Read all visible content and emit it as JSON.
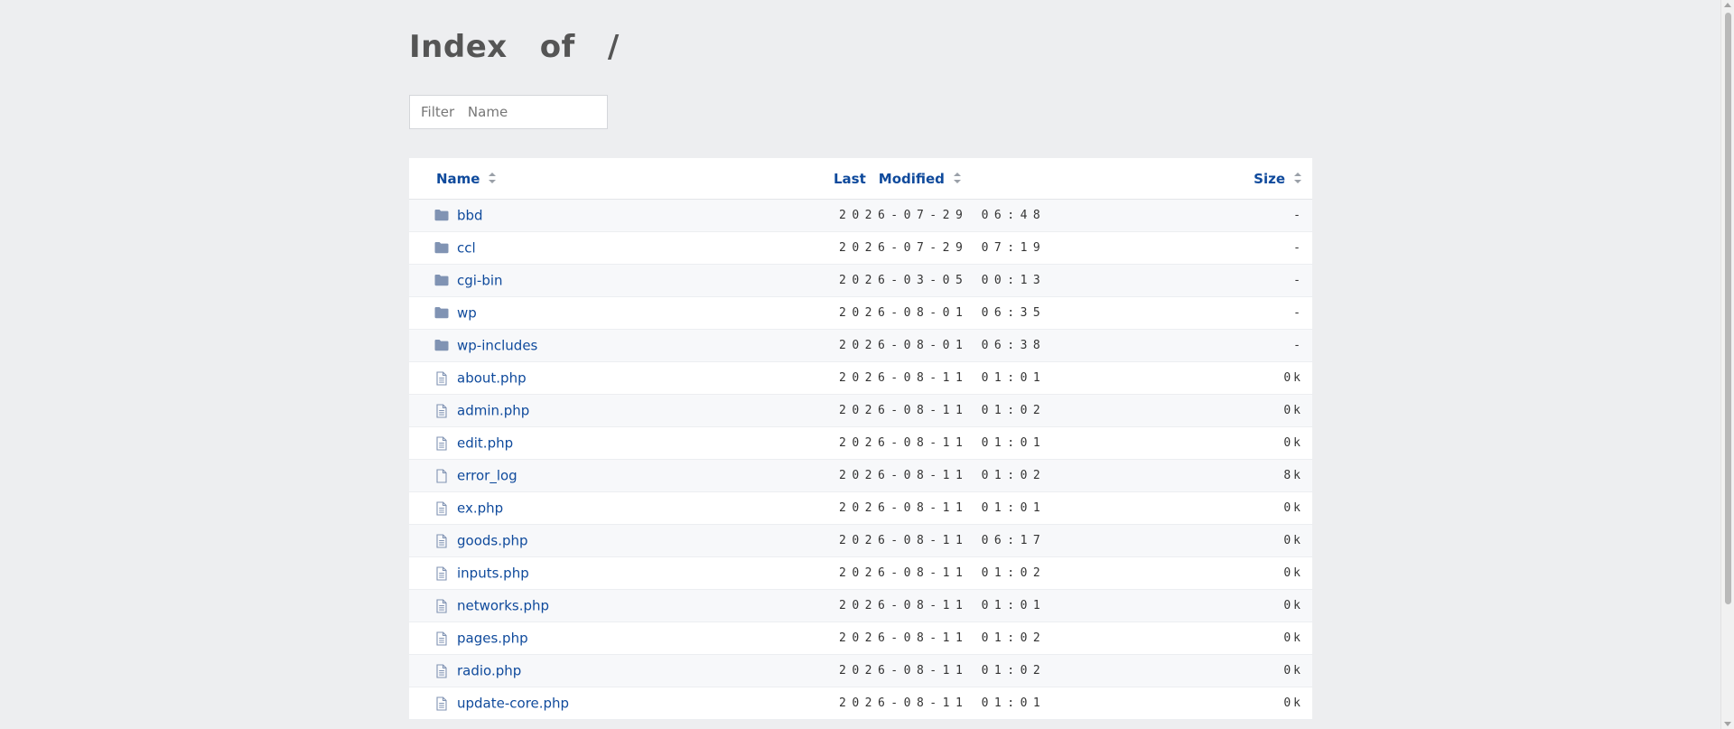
{
  "header": {
    "title_parts": [
      "Index",
      "of",
      "/"
    ]
  },
  "filter": {
    "placeholder": "Filter Name"
  },
  "table": {
    "columns": {
      "name": "Name",
      "last": "Last",
      "modified": "Modified",
      "size": "Size"
    },
    "rows": [
      {
        "type": "folder",
        "name": "bbd",
        "modified": "2026-07-29 06:48",
        "size": "-"
      },
      {
        "type": "folder",
        "name": "ccl",
        "modified": "2026-07-29 07:19",
        "size": "-"
      },
      {
        "type": "folder",
        "name": "cgi-bin",
        "modified": "2026-03-05 00:13",
        "size": "-"
      },
      {
        "type": "folder",
        "name": "wp",
        "modified": "2026-08-01 06:35",
        "size": "-"
      },
      {
        "type": "folder",
        "name": "wp-includes",
        "modified": "2026-08-01 06:38",
        "size": "-"
      },
      {
        "type": "php",
        "name": "about.php",
        "modified": "2026-08-11 01:01",
        "size": "0k"
      },
      {
        "type": "php",
        "name": "admin.php",
        "modified": "2026-08-11 01:02",
        "size": "0k"
      },
      {
        "type": "php",
        "name": "edit.php",
        "modified": "2026-08-11 01:01",
        "size": "0k"
      },
      {
        "type": "file",
        "name": "error_log",
        "modified": "2026-08-11 01:02",
        "size": "8k"
      },
      {
        "type": "php",
        "name": "ex.php",
        "modified": "2026-08-11 01:01",
        "size": "0k"
      },
      {
        "type": "php",
        "name": "goods.php",
        "modified": "2026-08-11 06:17",
        "size": "0k"
      },
      {
        "type": "php",
        "name": "inputs.php",
        "modified": "2026-08-11 01:02",
        "size": "0k"
      },
      {
        "type": "php",
        "name": "networks.php",
        "modified": "2026-08-11 01:01",
        "size": "0k"
      },
      {
        "type": "php",
        "name": "pages.php",
        "modified": "2026-08-11 01:02",
        "size": "0k"
      },
      {
        "type": "php",
        "name": "radio.php",
        "modified": "2026-08-11 01:02",
        "size": "0k"
      },
      {
        "type": "php",
        "name": "update-core.php",
        "modified": "2026-08-11 01:01",
        "size": "0k"
      }
    ]
  },
  "icons": {
    "folder": "folder-icon",
    "php": "document-icon",
    "file": "file-icon"
  },
  "colors": {
    "link": "#0f4a9c",
    "folder_icon": "#8093b3",
    "background": "#edeef0"
  }
}
